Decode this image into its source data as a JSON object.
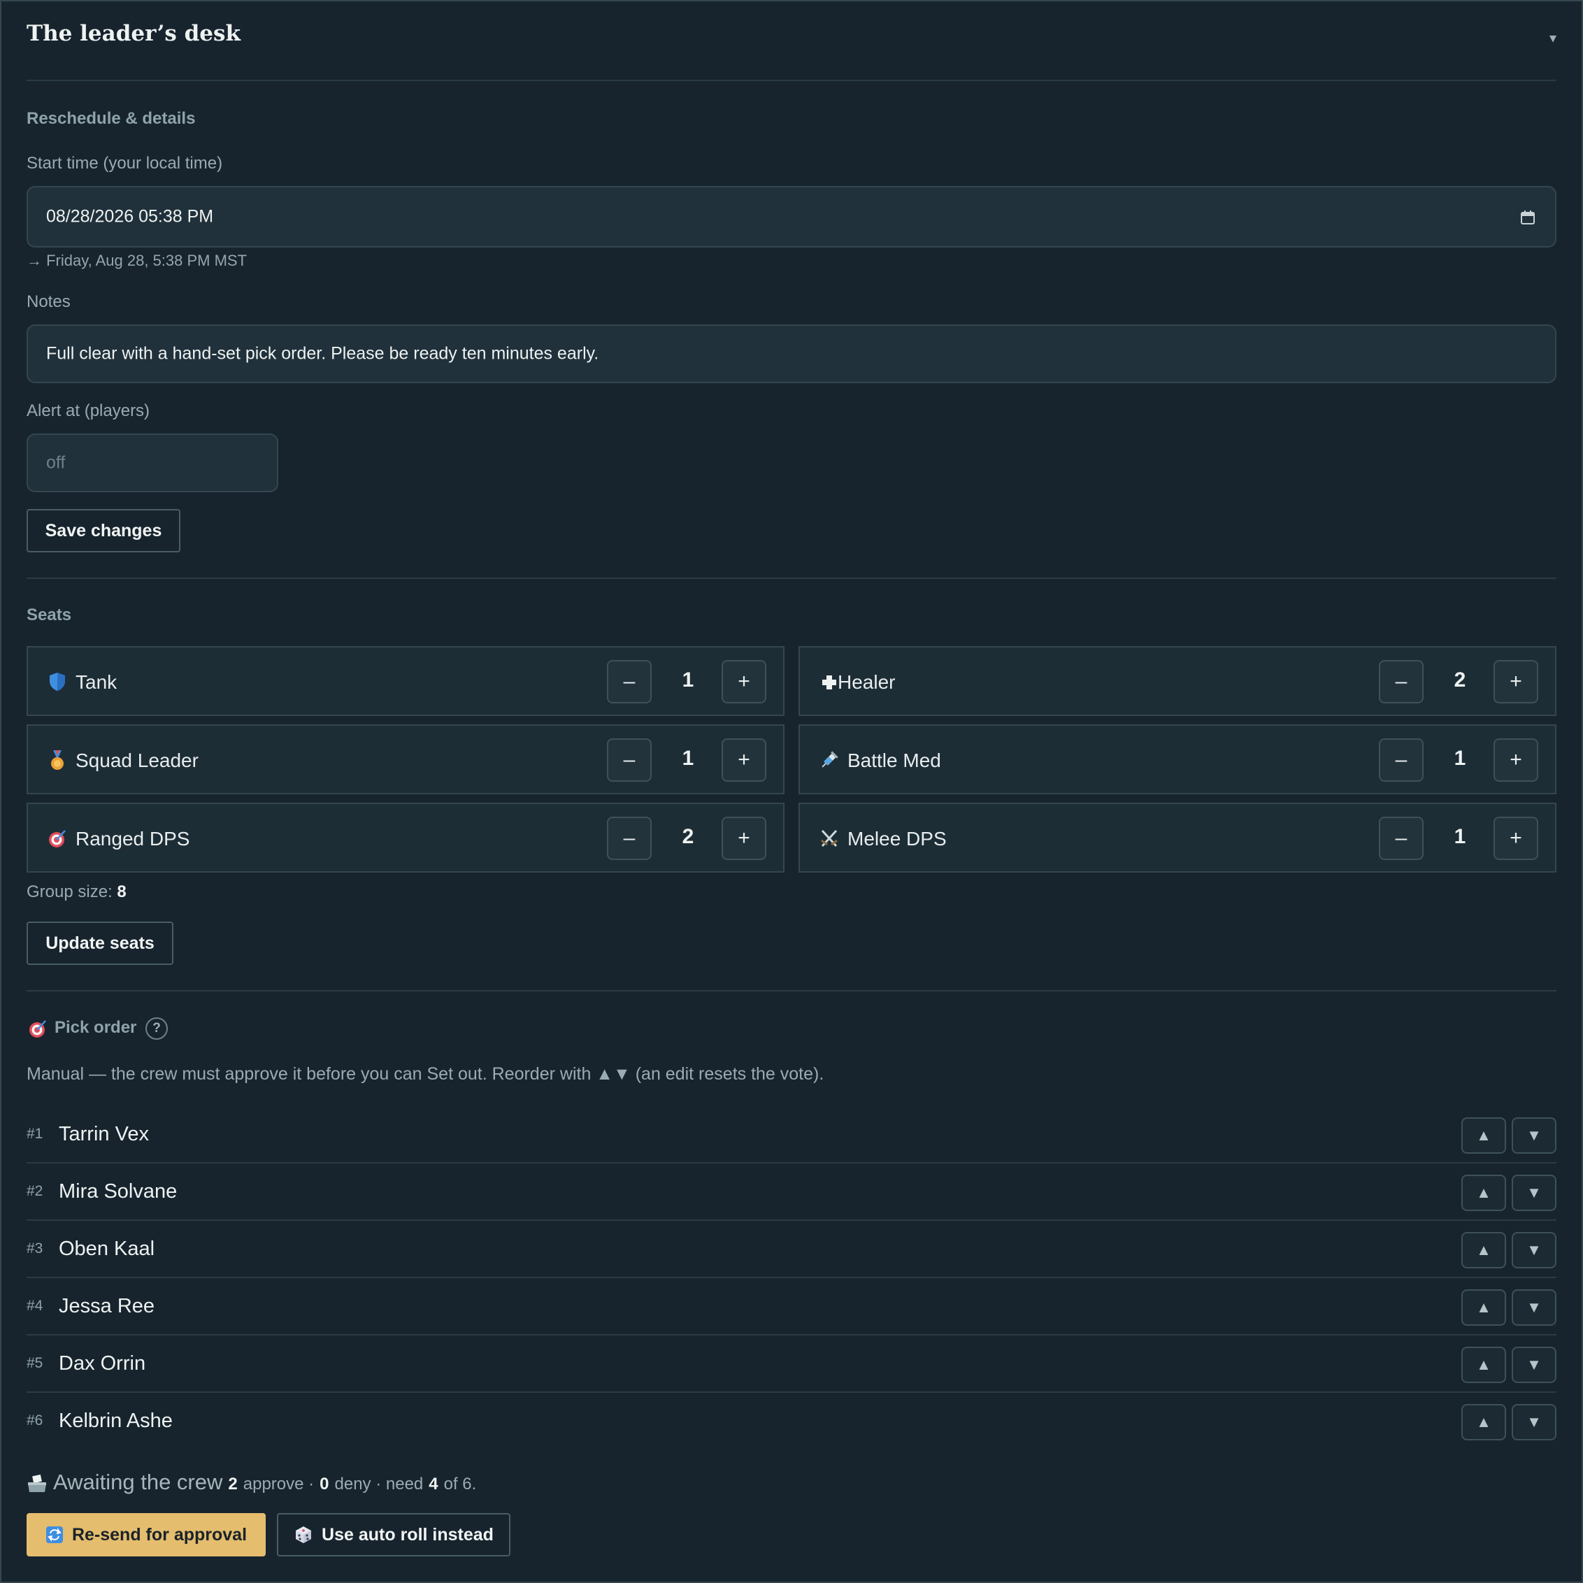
{
  "header": {
    "title": "The leader’s desk",
    "collapse_glyph": "▾"
  },
  "details": {
    "section": "Reschedule & details",
    "start_label": "Start time (your local time)",
    "start_value": "08/28/2026 05:38 PM",
    "start_hint": "→ Friday, Aug 28, 5:38 PM MST",
    "notes_label": "Notes",
    "notes_value": "Full clear with a hand-set pick order. Please be ready ten minutes early.",
    "alert_label": "Alert at (players)",
    "alert_placeholder": "off",
    "save_label": "Save changes"
  },
  "seats": {
    "section": "Seats",
    "minus_glyph": "–",
    "plus_glyph": "+",
    "items": [
      {
        "name": "Tank",
        "count": "1",
        "icon": "shield-icon"
      },
      {
        "name": "Healer",
        "count": "2",
        "icon": "cross-icon"
      },
      {
        "name": "Squad Leader",
        "count": "1",
        "icon": "medal-icon"
      },
      {
        "name": "Battle Med",
        "count": "1",
        "icon": "syringe-icon"
      },
      {
        "name": "Ranged DPS",
        "count": "2",
        "icon": "target-icon"
      },
      {
        "name": "Melee DPS",
        "count": "1",
        "icon": "crossed-swords-icon"
      }
    ],
    "group_size_label": "Group size:",
    "group_size": "8",
    "update_label": "Update seats"
  },
  "pick": {
    "section": "Pick order",
    "help_glyph": "?",
    "description": "Manual — the crew must approve it before you can Set out. Reorder with ▲▼ (an edit resets the vote).",
    "up_glyph": "▲",
    "down_glyph": "▼",
    "players": [
      {
        "rank": "#1",
        "name": "Tarrin Vex"
      },
      {
        "rank": "#2",
        "name": "Mira Solvane"
      },
      {
        "rank": "#3",
        "name": "Oben Kaal"
      },
      {
        "rank": "#4",
        "name": "Jessa Ree"
      },
      {
        "rank": "#5",
        "name": "Dax Orrin"
      },
      {
        "rank": "#6",
        "name": "Kelbrin Ashe"
      }
    ]
  },
  "vote": {
    "status": "Awaiting the crew",
    "approve_count": "2",
    "approve_label": "approve ·",
    "deny_count": "0",
    "deny_label": "deny · need",
    "need_count": "4",
    "need_suffix": "of 6.",
    "resend_label": "Re-send for approval",
    "auto_label": "Use auto roll instead"
  },
  "colors": {
    "background": "#17242e",
    "accent": "#e4bd6e",
    "border": "#34464f"
  }
}
